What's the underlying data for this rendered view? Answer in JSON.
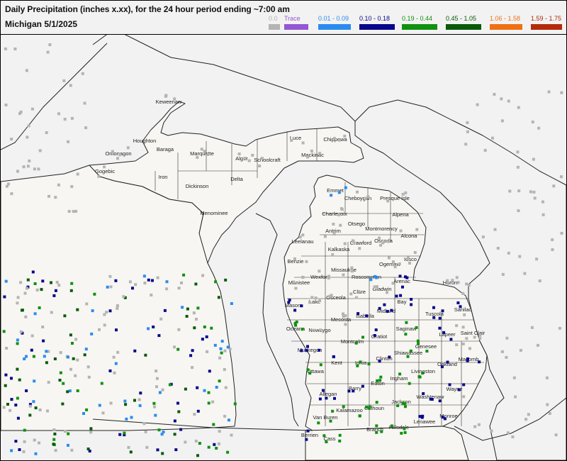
{
  "title": "Daily Precipitation (inches  x.xx),  for the 24 hour period ending ~7:00 am",
  "subtitle": "Michigan 5/1/2025",
  "legend": [
    {
      "label": "0.0",
      "color": "#b4b4b4"
    },
    {
      "label": "Trace",
      "color": "#9457d5"
    },
    {
      "label": "0.01 - 0.09",
      "color": "#2a8cf0"
    },
    {
      "label": "0.10 - 0.18",
      "color": "#08088c"
    },
    {
      "label": "0.19 - 0.44",
      "color": "#109110"
    },
    {
      "label": "0.45 - 1.05",
      "color": "#0a5a0a"
    },
    {
      "label": "1.06 - 1.58",
      "color": "#f07014"
    },
    {
      "label": "1.59 - 1.75",
      "color": "#b42a0a"
    }
  ],
  "counties": [
    "Keweenaw",
    "Houghton",
    "Ontonagon",
    "Baraga",
    "Marquette",
    "Alger",
    "Schoolcraft",
    "Luce",
    "Chippewa",
    "Mackinac",
    "Gogebic",
    "Iron",
    "Dickinson",
    "Delta",
    "Menominee",
    "Emmet",
    "Cheboygan",
    "Presque Isle",
    "Charlevoix",
    "Otsego",
    "Montmorency",
    "Alpena",
    "Antrim",
    "Crawford",
    "Oscoda",
    "Alcona",
    "Leelanau",
    "Kalkaska",
    "Benzie",
    "Missaukee",
    "Roscommon",
    "Ogemaw",
    "Iosco",
    "Wexford",
    "Manistee",
    "Arenac",
    "Huron",
    "Osceola",
    "Clare",
    "Gladwin",
    "Lake",
    "Bay",
    "Mason",
    "Mecosta",
    "Isabella",
    "Midland",
    "Tuscola",
    "Sanilac",
    "Oceana",
    "Newaygo",
    "Saginaw",
    "Lapeer",
    "Saint Clair",
    "Muskegon",
    "Montcalm",
    "Gratiot",
    "Genesee",
    "Kent",
    "Ionia",
    "Clinton",
    "Shiawassee",
    "Oakland",
    "Ottawa",
    "Livingston",
    "Macomb",
    "Allegan",
    "Barry",
    "Eaton",
    "Ingham",
    "Wayne",
    "Van Buren",
    "Kalamazoo",
    "Calhoun",
    "Jackson",
    "Washtenaw",
    "Monroe",
    "Berrien",
    "Cass",
    "Branch",
    "Hillsdale",
    "Lenawee"
  ],
  "stations": [
    {
      "name": "Ontonagon",
      "precip": 0.0
    },
    {
      "name": "Gogebic",
      "precip": 0.0
    },
    {
      "name": "Keweenaw",
      "precip": 0.0
    },
    {
      "name": "Marquette",
      "precip": 0.0
    },
    {
      "name": "Schoolcraft",
      "precip": 0.0
    },
    {
      "name": "Chippewa",
      "precip": 0.0
    },
    {
      "name": "Mackinac",
      "precip": 0.0
    },
    {
      "name": "Luce",
      "precip": 0.0
    },
    {
      "name": "Alger",
      "precip": 0.0
    },
    {
      "name": "Emmet",
      "precip": 0.05
    },
    {
      "name": "Cheboygan",
      "precip": 0.0
    },
    {
      "name": "Presque Isle",
      "precip": 0.0
    },
    {
      "name": "Charlevoix",
      "precip": 0.0
    },
    {
      "name": "Antrim",
      "precip": 0.0
    },
    {
      "name": "Leelanau",
      "precip": 0.0
    },
    {
      "name": "Kalkaska",
      "precip": 0.0
    },
    {
      "name": "Crawford",
      "precip": 0.0
    },
    {
      "name": "Oscoda",
      "precip": 0.0
    },
    {
      "name": "Alcona",
      "precip": 0.0
    },
    {
      "name": "Benzie",
      "precip": 0.0
    },
    {
      "name": "Wexford",
      "precip": 0.0
    },
    {
      "name": "Missaukee",
      "precip": 0.0
    },
    {
      "name": "Roscommon",
      "precip": 0.05
    },
    {
      "name": "Ogemaw",
      "precip": 0.0
    },
    {
      "name": "Iosco",
      "precip": 0.0
    },
    {
      "name": "Manistee",
      "precip": 0.0
    },
    {
      "name": "Arenac",
      "precip": 0.12
    },
    {
      "name": "Huron",
      "precip": 0.0
    },
    {
      "name": "Osceola",
      "precip": 0.0
    },
    {
      "name": "Clare",
      "precip": 0.0
    },
    {
      "name": "Gladwin",
      "precip": 0.0
    },
    {
      "name": "Lake",
      "precip": 0.0
    },
    {
      "name": "Bay",
      "precip": 0.14
    },
    {
      "name": "Mason",
      "precip": 0.12
    },
    {
      "name": "Mecosta",
      "precip": 0.0
    },
    {
      "name": "Isabella",
      "precip": 0.15
    },
    {
      "name": "Midland",
      "precip": 0.13
    },
    {
      "name": "Tuscola",
      "precip": 0.12
    },
    {
      "name": "Sanilac",
      "precip": 0.15
    },
    {
      "name": "Oceana",
      "precip": 0.25
    },
    {
      "name": "Newaygo",
      "precip": 0.0
    },
    {
      "name": "Saginaw",
      "precip": 0.25
    },
    {
      "name": "Lapeer",
      "precip": 0.14
    },
    {
      "name": "Saint Clair",
      "precip": 0.0
    },
    {
      "name": "Muskegon",
      "precip": 0.15
    },
    {
      "name": "Montcalm",
      "precip": 0.3
    },
    {
      "name": "Gratiot",
      "precip": 0.13
    },
    {
      "name": "Genesee",
      "precip": 0.3
    },
    {
      "name": "Kent",
      "precip": 0.12
    },
    {
      "name": "Ionia",
      "precip": 0.3
    },
    {
      "name": "Clinton",
      "precip": 0.13
    },
    {
      "name": "Shiawassee",
      "precip": 0.3
    },
    {
      "name": "Oakland",
      "precip": 0.12
    },
    {
      "name": "Ottawa",
      "precip": 0.3
    },
    {
      "name": "Livingston",
      "precip": 0.3
    },
    {
      "name": "Macomb",
      "precip": 0.14
    },
    {
      "name": "Allegan",
      "precip": 0.12
    },
    {
      "name": "Barry",
      "precip": 0.14
    },
    {
      "name": "Eaton",
      "precip": 0.3
    },
    {
      "name": "Ingham",
      "precip": 0.3
    },
    {
      "name": "Wayne",
      "precip": 0.13
    },
    {
      "name": "Van Buren",
      "precip": 0.3
    },
    {
      "name": "Kalamazoo",
      "precip": 0.3
    },
    {
      "name": "Calhoun",
      "precip": 0.3
    },
    {
      "name": "Jackson",
      "precip": 0.3
    },
    {
      "name": "Washtenaw",
      "precip": 0.12
    },
    {
      "name": "Monroe",
      "precip": 0.12
    },
    {
      "name": "Berrien",
      "precip": 0.15
    },
    {
      "name": "Cass",
      "precip": 0.3
    },
    {
      "name": "Branch",
      "precip": 0.3
    },
    {
      "name": "Hillsdale",
      "precip": 0.3
    },
    {
      "name": "Lenawee",
      "precip": 0.12
    }
  ]
}
